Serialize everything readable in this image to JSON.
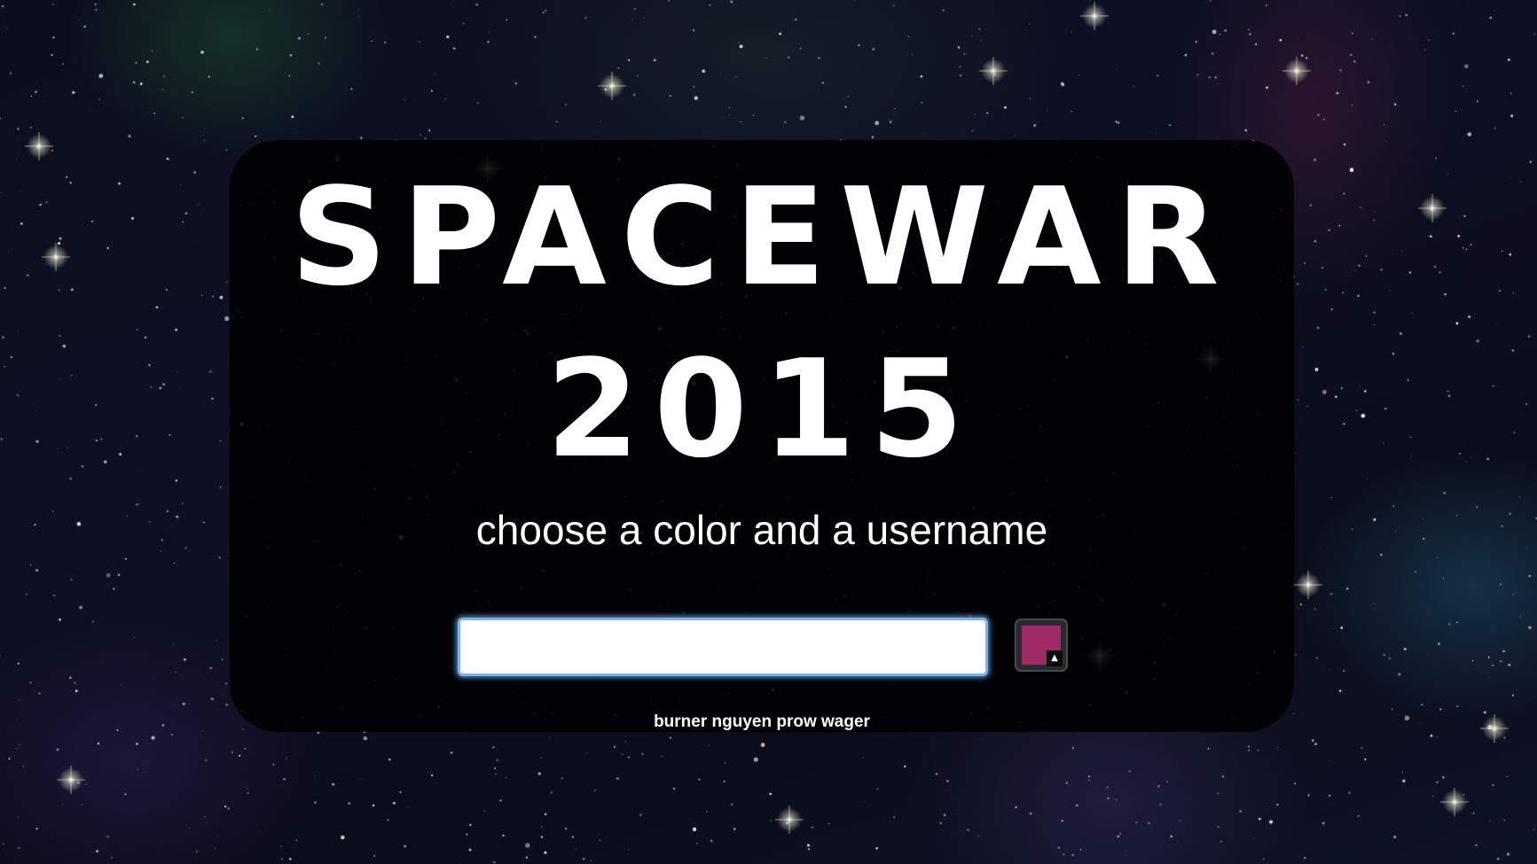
{
  "title": {
    "line1": "SPACEWAR",
    "line2": "2015"
  },
  "subtitle": "choose a color and a username",
  "username_input": {
    "value": "",
    "placeholder": ""
  },
  "color_picker": {
    "selected_color": "#a02a68",
    "arrow_icon": "caret-up-icon"
  },
  "suggested_name": "burner nguyen prow wager",
  "colors": {
    "panel": "#000000",
    "text": "#ffffff",
    "input_focus_glow": "#7eb3e6"
  }
}
